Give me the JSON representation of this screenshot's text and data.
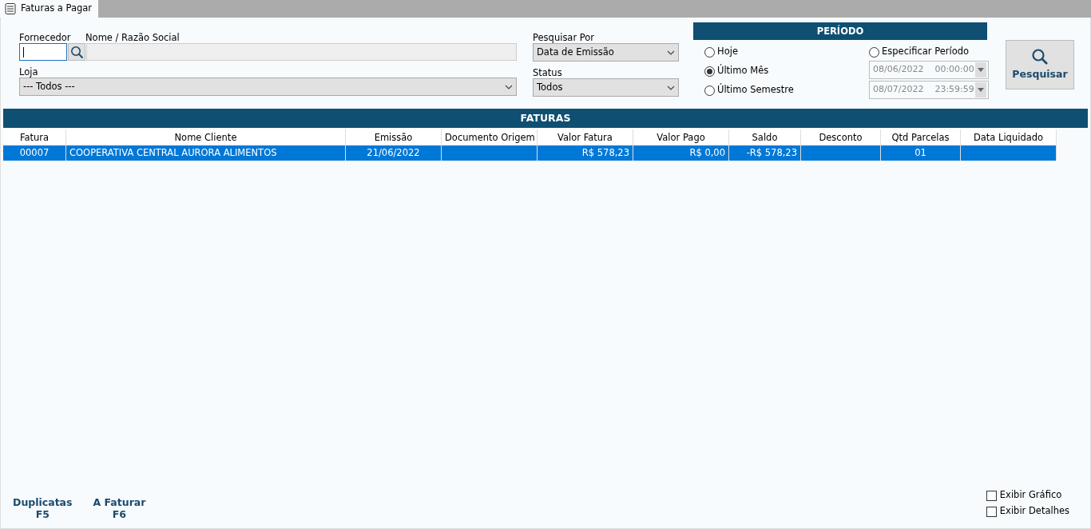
{
  "tabs": [
    {
      "label": "Faturas a Pagar",
      "selected": true
    }
  ],
  "filters": {
    "fornecedor": {
      "label": "Fornecedor"
    },
    "nome": {
      "label": "Nome / Razão Social"
    },
    "loja": {
      "label": "Loja",
      "value": "--- Todos ---"
    },
    "pesquisar_por": {
      "label": "Pesquisar Por",
      "value": "Data de Emissão"
    },
    "status": {
      "label": "Status",
      "value": "Todos"
    }
  },
  "periodo": {
    "title": "PERÍODO",
    "options": [
      {
        "label": "Hoje",
        "selected": false
      },
      {
        "label": "Último Mês",
        "selected": true
      },
      {
        "label": "Último Semestre",
        "selected": false
      },
      {
        "label": "Especificar Período",
        "selected": false
      }
    ],
    "from": {
      "date": "08/06/2022",
      "time": "00:00:00",
      "disabled": true
    },
    "to": {
      "date": "08/07/2022",
      "time": "23:59:59",
      "disabled": true
    }
  },
  "search_button": "Pesquisar",
  "table": {
    "title": "FATURAS",
    "columns": [
      "Fatura",
      "Nome Cliente",
      "Emissão",
      "Documento Origem",
      "Valor Fatura",
      "Valor Pago",
      "Saldo",
      "Desconto",
      "Qtd Parcelas",
      "Data Liquidado"
    ],
    "rows": [
      {
        "selected": true,
        "cells": [
          "00007",
          "COOPERATIVA CENTRAL AURORA ALIMENTOS",
          "21/06/2022",
          "",
          "R$ 578,23",
          "R$ 0,00",
          "-R$ 578,23",
          "",
          "01",
          ""
        ]
      }
    ]
  },
  "footer": {
    "actions": [
      {
        "label": "Duplicatas",
        "key": "F5"
      },
      {
        "label": "A Faturar",
        "key": "F6"
      }
    ],
    "checks": [
      {
        "label": "Exibir Gráfico",
        "checked": false
      },
      {
        "label": "Exibir Detalhes",
        "checked": false
      }
    ]
  }
}
